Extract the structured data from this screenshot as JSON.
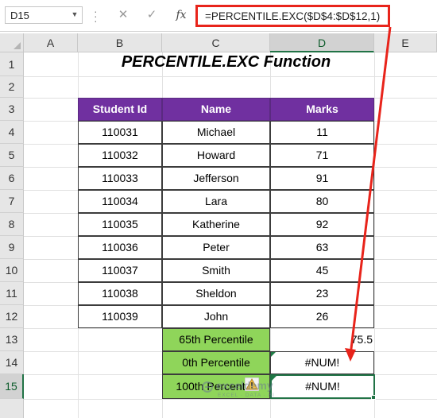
{
  "name_box": {
    "value": "D15"
  },
  "formula_bar": {
    "formula": "=PERCENTILE.EXC($D$4:$D$12,1)",
    "cancel_icon": "✕",
    "enter_icon": "✓",
    "fx_label": "fx"
  },
  "columns": [
    "A",
    "B",
    "C",
    "D",
    "E"
  ],
  "rows": [
    "1",
    "2",
    "3",
    "4",
    "5",
    "6",
    "7",
    "8",
    "9",
    "10",
    "11",
    "12",
    "13",
    "14",
    "15"
  ],
  "title": "PERCENTILE.EXC Function",
  "table": {
    "headers": [
      "Student Id",
      "Name",
      "Marks"
    ],
    "rows": [
      [
        "110031",
        "Michael",
        "11"
      ],
      [
        "110032",
        "Howard",
        "71"
      ],
      [
        "110033",
        "Jefferson",
        "91"
      ],
      [
        "110034",
        "Lara",
        "80"
      ],
      [
        "110035",
        "Katherine",
        "92"
      ],
      [
        "110036",
        "Peter",
        "63"
      ],
      [
        "110037",
        "Smith",
        "45"
      ],
      [
        "110038",
        "Sheldon",
        "23"
      ],
      [
        "110039",
        "John",
        "26"
      ]
    ]
  },
  "results": [
    {
      "label": "65th Percentile",
      "value": "75.5"
    },
    {
      "label": "0th Percentile",
      "value": "#NUM!"
    },
    {
      "label": "100th Percentile",
      "value": "#NUM!"
    }
  ],
  "watermark": {
    "brand": "exceldemy",
    "tagline": "EXCEL · DATA · BI"
  },
  "colors": {
    "header_purple": "#7030a0",
    "label_green": "#8fd55a",
    "highlight_red": "#e8241b",
    "selection_green": "#217346"
  }
}
